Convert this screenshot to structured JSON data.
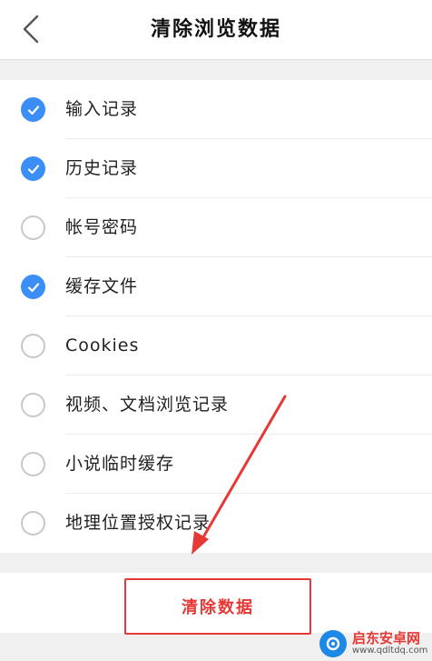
{
  "header": {
    "title": "清除浏览数据",
    "back_icon": "chevron-left-icon"
  },
  "options": [
    {
      "label": "输入记录",
      "checked": true
    },
    {
      "label": "历史记录",
      "checked": true
    },
    {
      "label": "帐号密码",
      "checked": false
    },
    {
      "label": "缓存文件",
      "checked": true
    },
    {
      "label": "Cookies",
      "checked": false
    },
    {
      "label": "视频、文档浏览记录",
      "checked": false
    },
    {
      "label": "小说临时缓存",
      "checked": false
    },
    {
      "label": "地理位置授权记录",
      "checked": false
    }
  ],
  "footer": {
    "clear_label": "清除数据"
  },
  "watermark": {
    "name": "启东安卓网",
    "url": "www.qdltdq.com"
  },
  "colors": {
    "accent": "#3a8ef6",
    "danger": "#e53935",
    "watermark_logo": "#1e88e5"
  }
}
